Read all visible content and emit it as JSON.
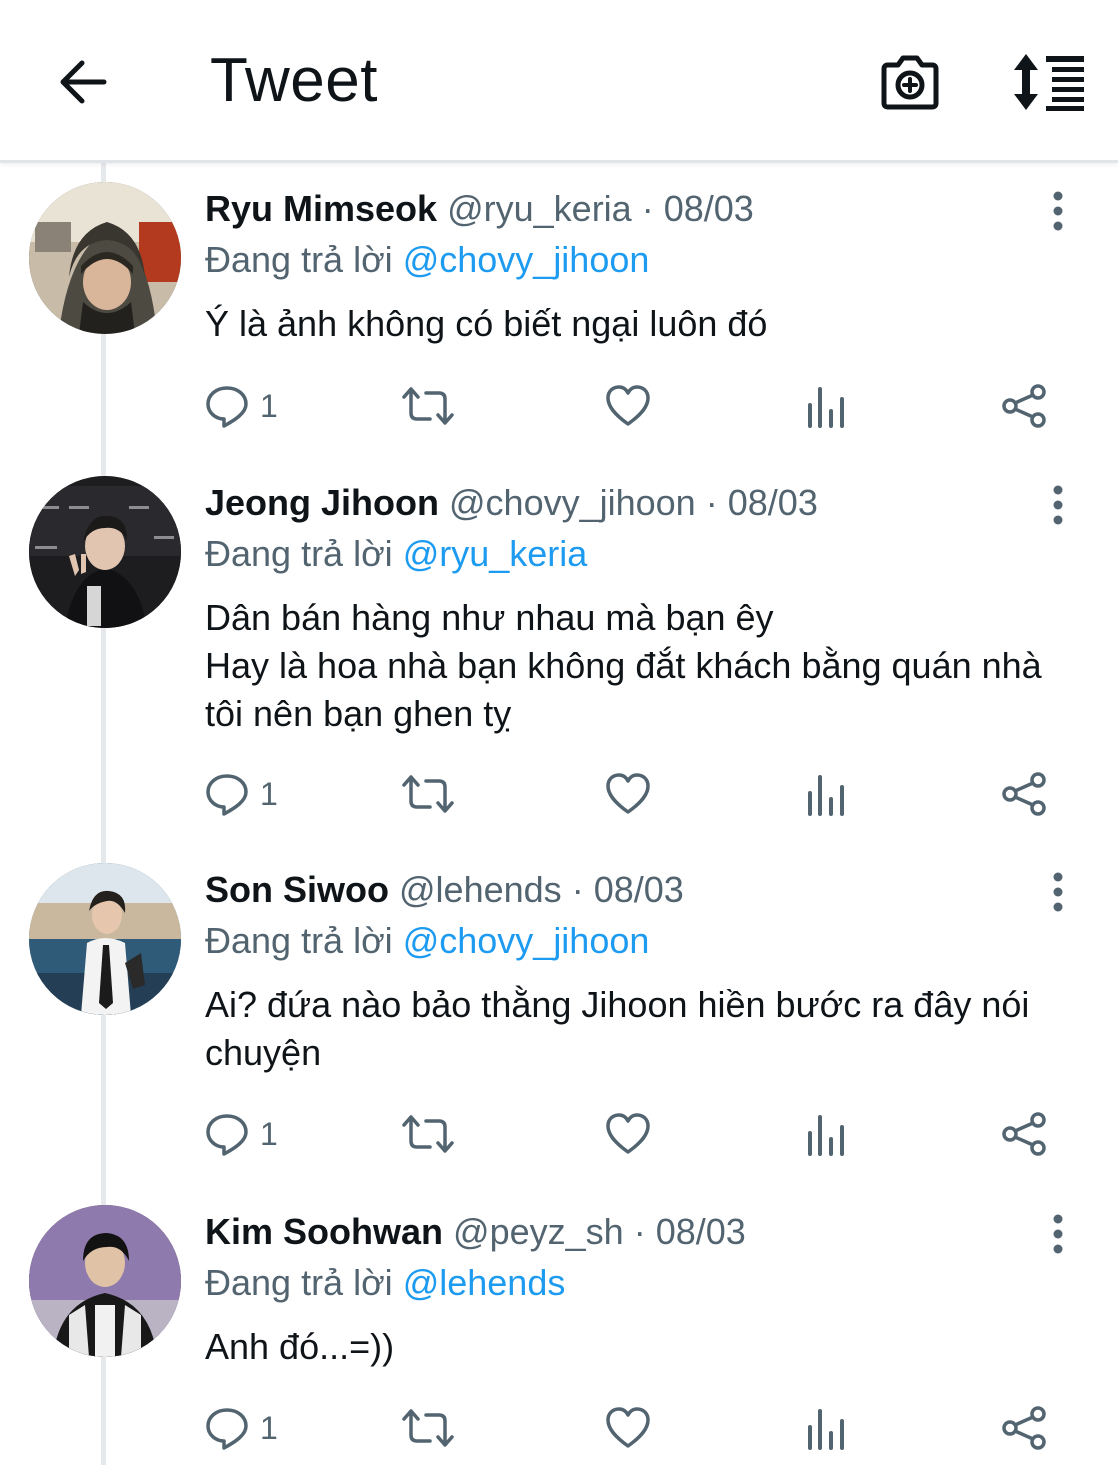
{
  "header": {
    "title": "Tweet",
    "back_icon": "arrow-left-icon",
    "camera_icon": "camera-plus-icon",
    "sort_icon": "sort-list-icon"
  },
  "colors": {
    "accent": "#1d9bf0",
    "secondary_text": "#536471",
    "primary_text": "#0f1419"
  },
  "tweets": [
    {
      "display_name": "Ryu Mimseok",
      "handle": "@ryu_keria",
      "separator": "·",
      "date": "08/03",
      "replying_prefix": "Đang trả lời",
      "replying_to": "@chovy_jihoon",
      "text": "Ý là ảnh không có biết ngại luôn đó",
      "reply_count": "1"
    },
    {
      "display_name": "Jeong Jihoon",
      "handle": "@chovy_jihoon",
      "separator": "·",
      "date": "08/03",
      "replying_prefix": "Đang trả lời",
      "replying_to": "@ryu_keria",
      "text": "Dân bán hàng như nhau mà bạn êy\nHay là hoa nhà bạn không đắt khách bằng quán nhà tôi nên bạn ghen tỵ",
      "reply_count": "1"
    },
    {
      "display_name": "Son Siwoo",
      "handle": "@lehends",
      "separator": "·",
      "date": "08/03",
      "replying_prefix": "Đang trả lời",
      "replying_to": "@chovy_jihoon",
      "text": "Ai? đứa nào bảo thằng Jihoon hiền bước ra đây nói chuyện",
      "reply_count": "1"
    },
    {
      "display_name": "Kim Soohwan",
      "handle": "@peyz_sh",
      "separator": "·",
      "date": "08/03",
      "replying_prefix": "Đang trả lời",
      "replying_to": "@lehends",
      "text": "Anh đó...=))",
      "reply_count": "1"
    }
  ]
}
